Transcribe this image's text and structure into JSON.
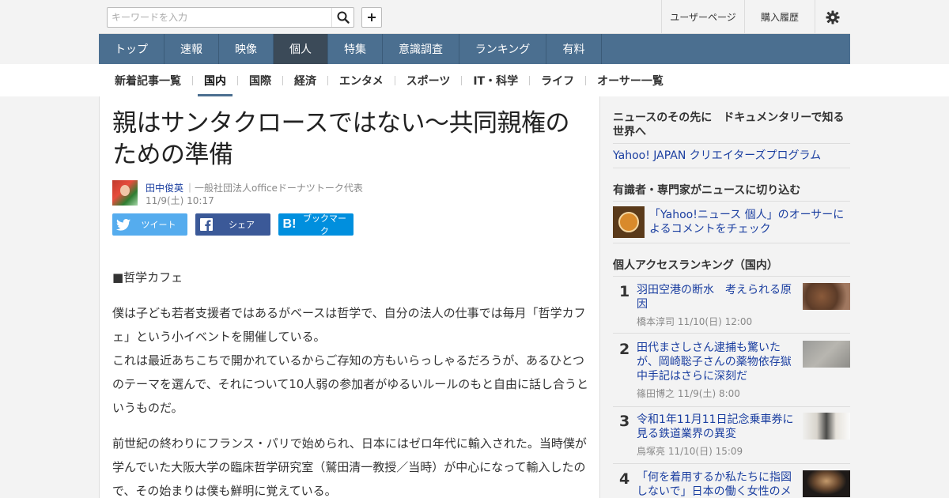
{
  "topbar": {
    "search_placeholder": "キーワードを入力",
    "user_page": "ユーザーページ",
    "purchase_history": "購入履歴"
  },
  "main_nav": [
    "トップ",
    "速報",
    "映像",
    "個人",
    "特集",
    "意識調査",
    "ランキング",
    "有料"
  ],
  "main_nav_active": "個人",
  "sub_nav": [
    "新着記事一覧",
    "国内",
    "国際",
    "経済",
    "エンタメ",
    "スポーツ",
    "IT・科学",
    "ライフ",
    "オーサー一覧"
  ],
  "sub_nav_active": "国内",
  "article": {
    "title": "親はサンタクロースではない～共同親権のための準備",
    "author_name": "田中俊英",
    "author_org": "｜一般社団法人officeドーナツトーク代表",
    "date": "11/9(土) 10:17",
    "share_tweet": "ツイート",
    "share_facebook": "シェア",
    "share_hatena": "ブックマーク",
    "paragraphs": [
      "■哲学カフェ",
      "僕は子ども若者支援者ではあるがベースは哲学で、自分の法人の仕事では毎月「哲学カフェ」という小イベントを開催している。",
      "これは最近あちこちで開かれているからご存知の方もいらっしゃるだろうが、あるひとつのテーマを選んで、それについて10人弱の参加者がゆるいルールのもと自由に話し合うというものだ。",
      "前世紀の終わりにフランス・パリで始められ、日本にはゼロ年代に輸入された。当時僕が学んでいた大阪大学の臨床哲学研究室（鷲田清一教授／当時）が中心になって輸入したので、その始まりは僕も鮮明に覚えている。"
    ]
  },
  "sidebar": {
    "promo_heading": "ニュースのその先に　ドキュメンタリーで知る世界へ",
    "promo_link": "Yahoo! JAPAN クリエイターズプログラム",
    "comment_heading": "有識者・専門家がニュースに切り込む",
    "comment_link": "「Yahoo!ニュース 個人」のオーサーによるコメントをチェック",
    "ranking_heading": "個人アクセスランキング（国内）",
    "ranking": [
      {
        "num": "1",
        "title": "羽田空港の断水　考えられる原因",
        "meta": "橋本淳司  11/10(日) 12:00"
      },
      {
        "num": "2",
        "title": "田代まさしさん逮捕も驚いたが、岡崎聡子さんの薬物依存獄中手記はさらに深刻だ",
        "meta": "篠田博之  11/9(土) 8:00"
      },
      {
        "num": "3",
        "title": "令和1年11月11日記念乗車券に見る鉄道業界の異変",
        "meta": "鳥塚亮  11/10(日) 15:09"
      },
      {
        "num": "4",
        "title": "「何を着用するか私たちに指図しないで」日本の働く女性のメ",
        "meta": ""
      }
    ]
  },
  "colors": {
    "nav_bg": "#4b6f90",
    "nav_active": "#3b4a58",
    "link": "#1a3ea0",
    "twitter": "#55acee",
    "facebook": "#3b5998",
    "hatena": "#008fde"
  }
}
